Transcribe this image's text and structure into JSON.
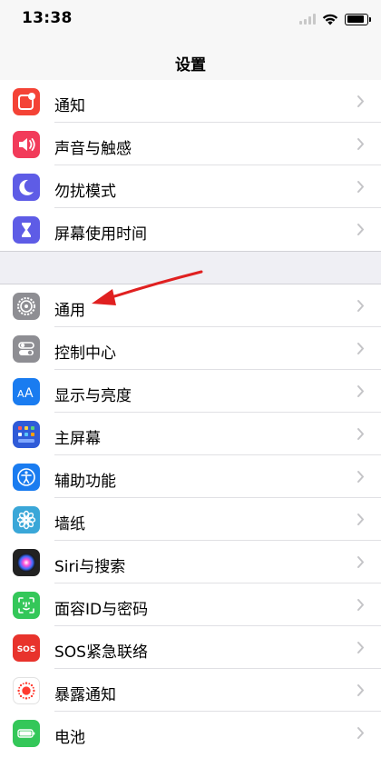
{
  "status_bar": {
    "time": "13:38",
    "icons": [
      "signal-icon",
      "wifi-icon",
      "battery-icon"
    ]
  },
  "nav": {
    "title": "设置"
  },
  "colors": {
    "background": "#efeff4",
    "annotation_arrow": "#e02020"
  },
  "settings_groups": [
    {
      "items": [
        {
          "label": "通知",
          "icon": "notifications-icon",
          "color": "#f44336"
        },
        {
          "label": "声音与触感",
          "icon": "sounds-icon",
          "color": "#f23b5a"
        },
        {
          "label": "勿扰模式",
          "icon": "moon-icon",
          "color": "#5e5ce6"
        },
        {
          "label": "屏幕使用时间",
          "icon": "hourglass-icon",
          "color": "#5e5ce6"
        }
      ]
    },
    {
      "items": [
        {
          "label": "通用",
          "icon": "gear-icon",
          "color": "#8e8e93"
        },
        {
          "label": "控制中心",
          "icon": "toggles-icon",
          "color": "#8e8e93"
        },
        {
          "label": "显示与亮度",
          "icon": "display-aa-icon",
          "color": "#1a7cf0"
        },
        {
          "label": "主屏幕",
          "icon": "home-screen-icon",
          "color": "#2f5bd8"
        },
        {
          "label": "辅助功能",
          "icon": "accessibility-icon",
          "color": "#1a7cf0"
        },
        {
          "label": "墙纸",
          "icon": "wallpaper-flower-icon",
          "color": "#3aa7d8"
        },
        {
          "label": "Siri与搜索",
          "icon": "siri-icon",
          "color": "#222222"
        },
        {
          "label": "面容ID与密码",
          "icon": "face-id-icon",
          "color": "#34c759"
        },
        {
          "label": "SOS紧急联络",
          "icon": "sos-icon",
          "color": "#e8332c"
        },
        {
          "label": "暴露通知",
          "icon": "exposure-icon",
          "color": "#ffffff"
        },
        {
          "label": "电池",
          "icon": "battery-icon",
          "color": "#34c759"
        }
      ]
    }
  ],
  "annotation": {
    "type": "arrow",
    "points_to": "通用"
  }
}
